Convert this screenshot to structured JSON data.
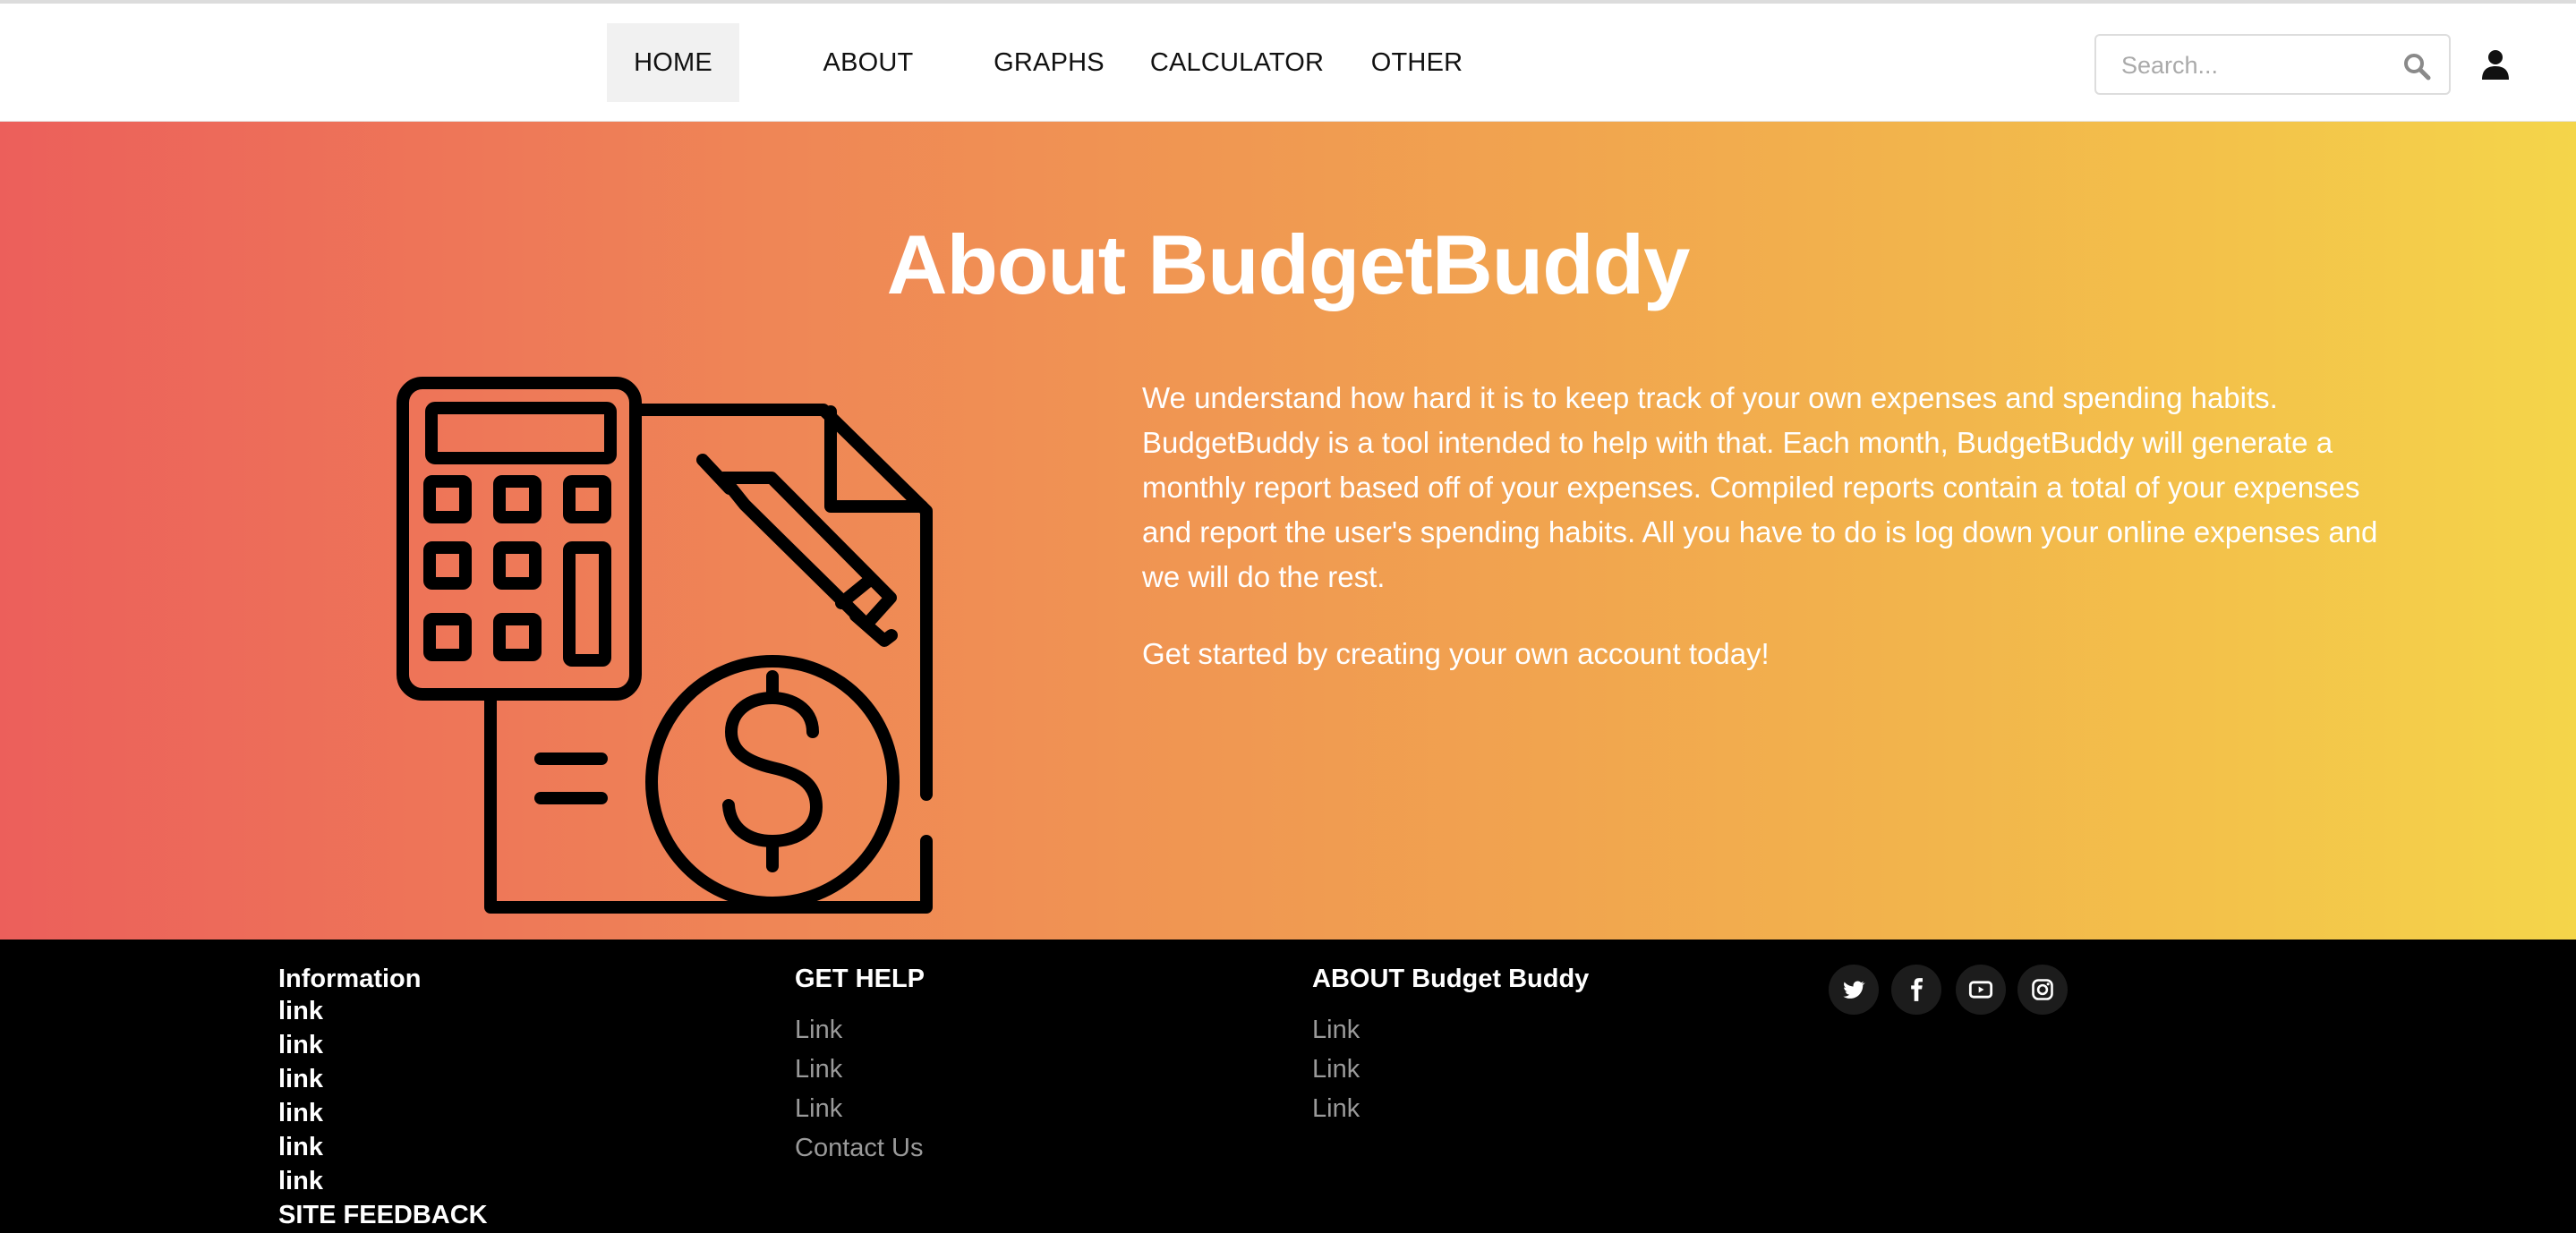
{
  "nav": {
    "items": [
      {
        "label": "HOME",
        "active": true
      },
      {
        "label": "ABOUT"
      },
      {
        "label": "GRAPHS"
      },
      {
        "label": "CALCULATOR"
      },
      {
        "label": "OTHER"
      }
    ],
    "search": {
      "placeholder": "Search...",
      "value": ""
    },
    "icons": {
      "search": "search-icon",
      "user": "user-icon"
    }
  },
  "hero": {
    "title": "About BudgetBuddy",
    "illustration": "calculator-document-dollar-icon",
    "paragraphs": [
      "We understand how hard it is to keep track of your own expenses and spending habits. BudgetBuddy is a tool intended to help with that. Each month, BudgetBuddy will generate a monthly report based off of your expenses. Compiled reports contain a total of your expenses and report the user's spending habits. All you have to do is log down your online expenses and we will do the rest.",
      "Get started by creating your own account today!"
    ]
  },
  "footer": {
    "information": {
      "heading": "Information",
      "links": [
        "link",
        "link",
        "link",
        "link",
        "link",
        "link"
      ],
      "feedback": "SITE FEEDBACK"
    },
    "get_help": {
      "heading": "GET HELP",
      "links": [
        "Link",
        "Link",
        "Link",
        "Contact Us"
      ]
    },
    "about": {
      "heading": "ABOUT Budget Buddy",
      "links": [
        "Link",
        "Link",
        "Link"
      ]
    },
    "social_icons": [
      "twitter-icon",
      "facebook-icon",
      "youtube-icon",
      "instagram-icon"
    ]
  },
  "colors": {
    "gradient_start": "#ec5f5b",
    "gradient_end": "#f4d54a",
    "footer_bg": "#000000",
    "footer_link": "#9a9a9a",
    "nav_active_bg": "#f1f1f1"
  }
}
